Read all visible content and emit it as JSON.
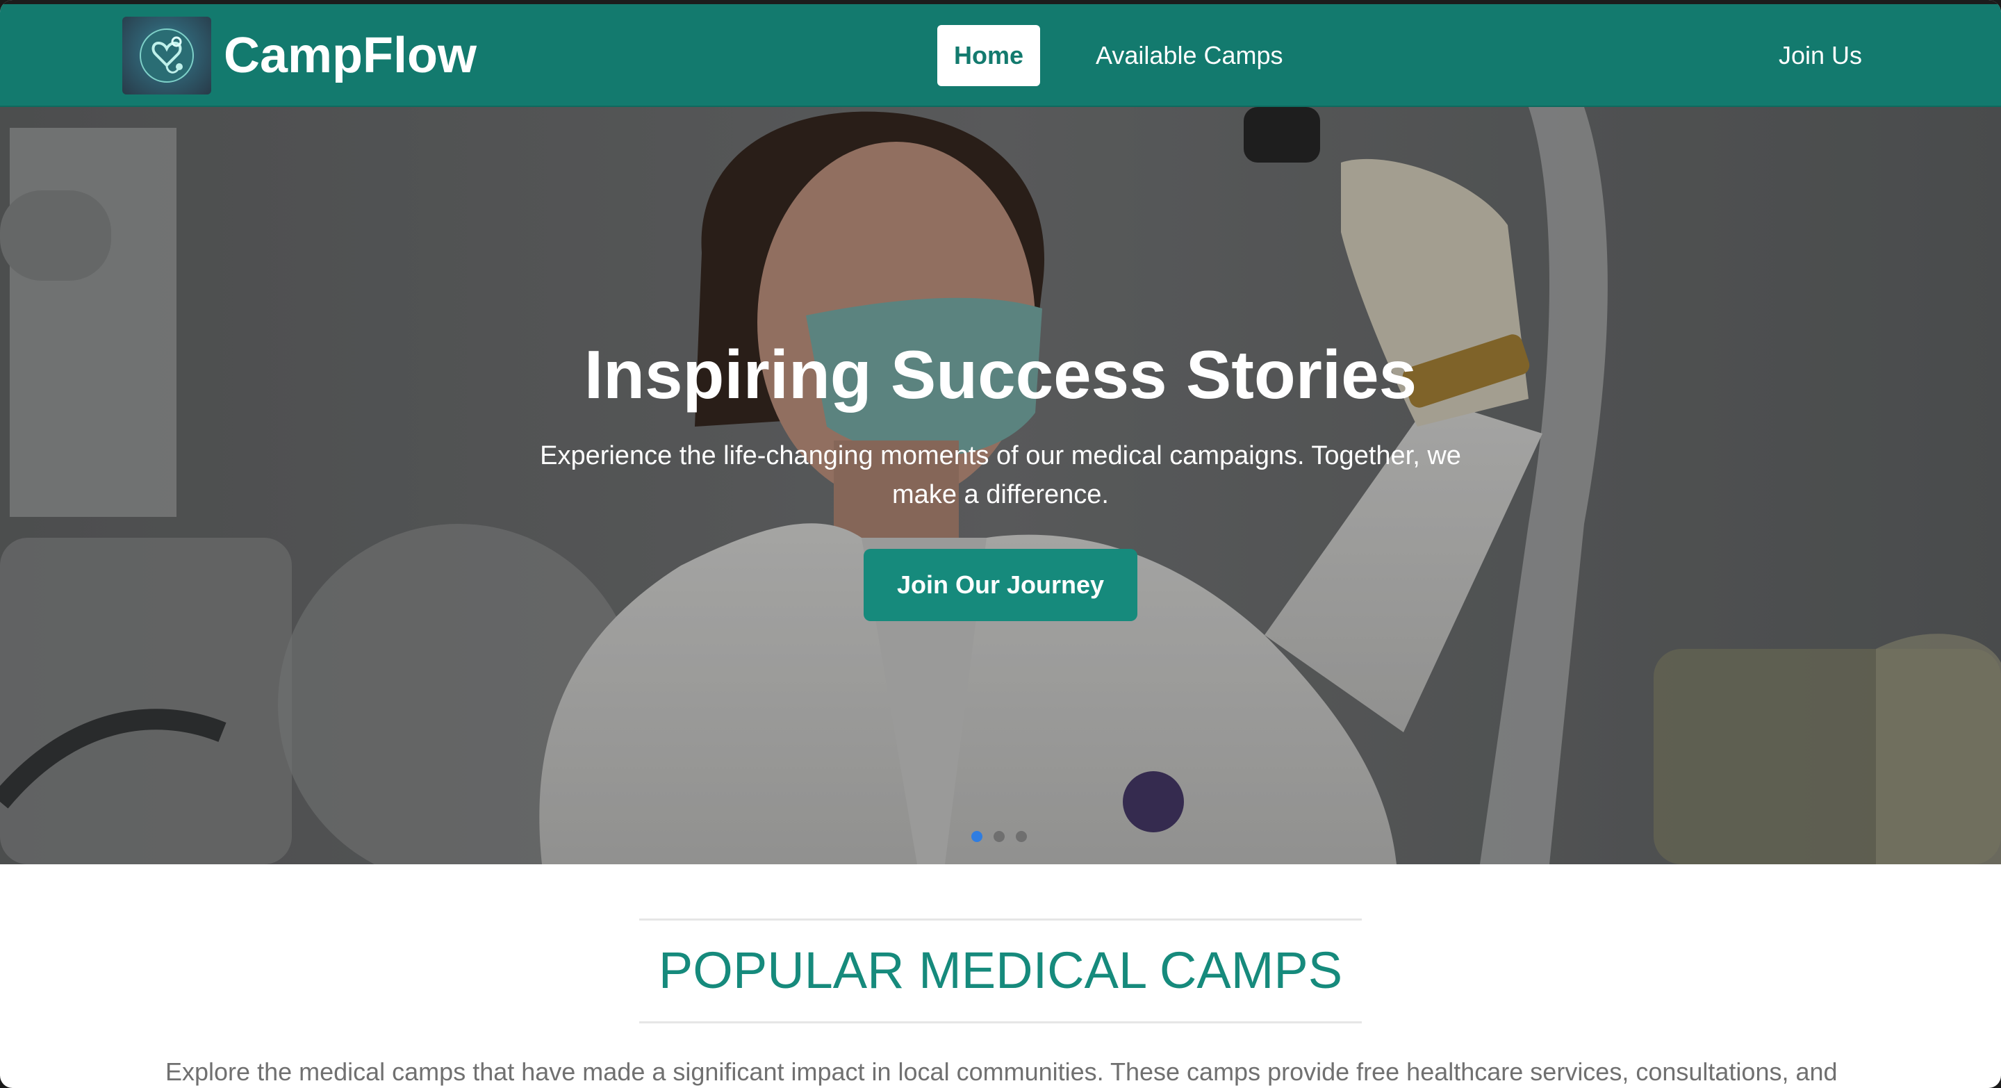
{
  "app": {
    "brand_name": "CampFlow"
  },
  "nav": {
    "items": [
      {
        "label": "Home",
        "active": true
      },
      {
        "label": "Available Camps",
        "active": false
      }
    ],
    "join_label": "Join Us"
  },
  "hero": {
    "title": "Inspiring Success Stories",
    "subtitle": "Experience the life-changing moments of our medical campaigns. Together, we make a difference.",
    "cta_label": "Join Our Journey",
    "carousel": {
      "slide_count": 3,
      "active_index": 0
    }
  },
  "popular": {
    "heading": "POPULAR MEDICAL CAMPS",
    "description": "Explore the medical camps that have made a significant impact in local communities. These camps provide free healthcare services, consultations, and"
  },
  "colors": {
    "brand_teal": "#137a6e",
    "button_teal": "#168a7c",
    "active_dot": "#2f7de1",
    "heading_teal": "#168a7c"
  },
  "icons": {
    "logo": "stethoscope-heart-logo-icon"
  }
}
